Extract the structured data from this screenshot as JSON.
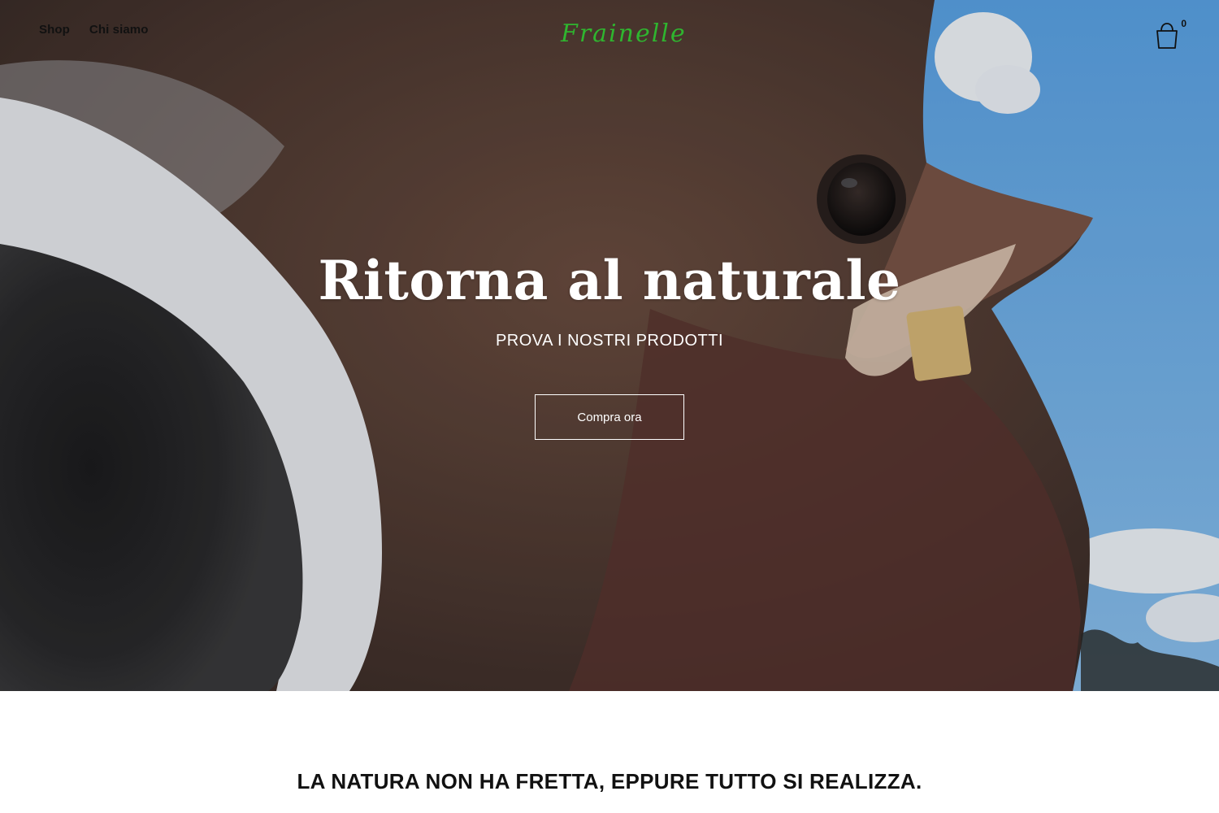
{
  "header": {
    "nav": [
      {
        "label": "Shop"
      },
      {
        "label": "Chi siamo"
      }
    ],
    "logo_text": "Frainelle",
    "cart_count": "0",
    "cart_icon": "shopping-bag-icon"
  },
  "hero": {
    "title": "Ritorna al naturale",
    "subtitle": "PROVA I NOSTRI PRODOTTI",
    "button_label": "Compra ora",
    "image": "cow-closeup-photo"
  },
  "quote": {
    "text": "LA NATURA NON HA FRETTA, EPPURE TUTTO SI REALIZZA."
  },
  "colors": {
    "logo": "#2fb52f",
    "hero_text": "#ffffff",
    "sky": "#6aaee8"
  }
}
